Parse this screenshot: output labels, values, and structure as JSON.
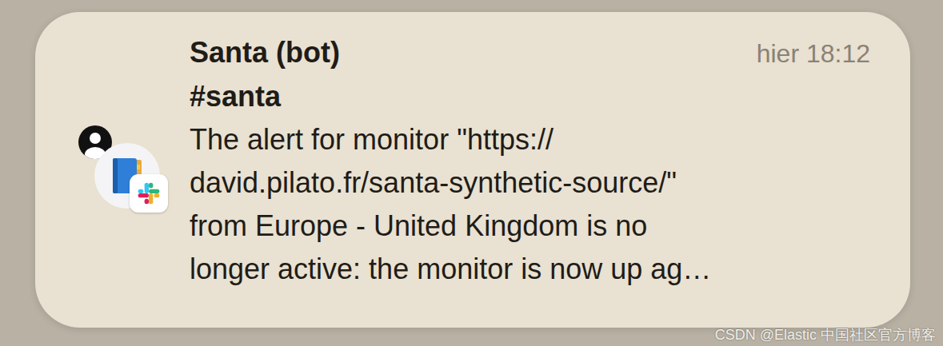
{
  "notification": {
    "sender": "Santa (bot)",
    "time": "hier 18:12",
    "channel": "#santa",
    "message_lines": [
      "The alert for monitor \"https://",
      "david.pilato.fr/santa-synthetic-source/\"",
      "from Europe - United Kingdom is no",
      "longer active: the monitor is now up ag…"
    ]
  },
  "watermark": "CSDN @Elastic 中国社区官方博客"
}
